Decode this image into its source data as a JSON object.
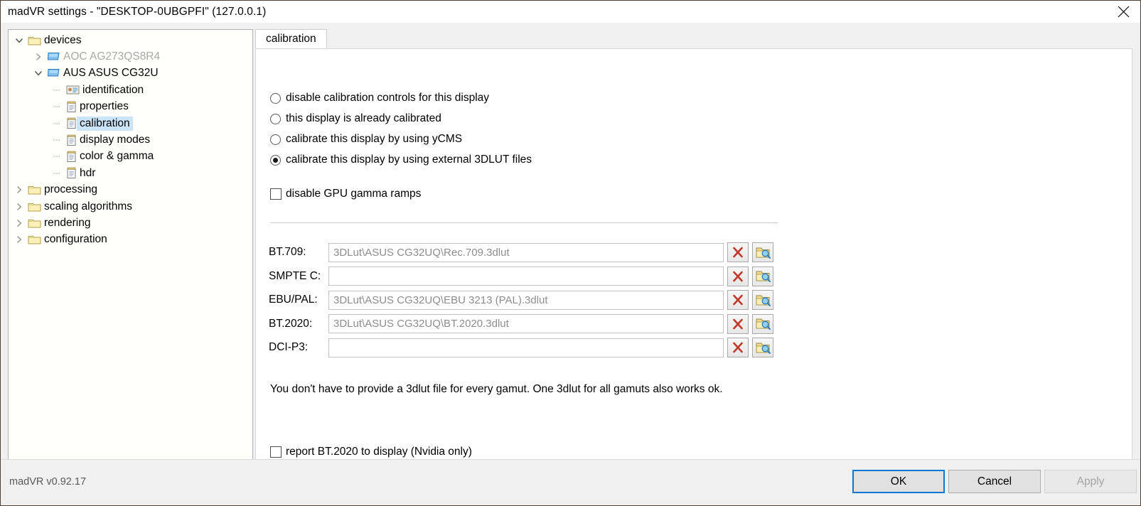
{
  "window": {
    "title": "madVR settings - \"DESKTOP-0UBGPFI\" (127.0.0.1)",
    "close_icon": "close-icon"
  },
  "tree": {
    "items": [
      {
        "label": "devices",
        "depth": 0,
        "icon": "folder-icon",
        "expander": "chevron-down",
        "state": "expanded",
        "dim": false,
        "selected": false
      },
      {
        "label": "AOC AG273QS8R4",
        "depth": 1,
        "icon": "display-icon",
        "expander": "chevron-right",
        "state": "collapsed",
        "dim": true,
        "selected": false
      },
      {
        "label": "AUS ASUS CG32U",
        "depth": 1,
        "icon": "display-icon",
        "expander": "chevron-down",
        "state": "expanded",
        "dim": false,
        "selected": false
      },
      {
        "label": "identification",
        "depth": 2,
        "icon": "id-card-icon",
        "expander": "none",
        "state": "leaf",
        "dim": false,
        "selected": false
      },
      {
        "label": "properties",
        "depth": 2,
        "icon": "page-icon",
        "expander": "none",
        "state": "leaf",
        "dim": false,
        "selected": false
      },
      {
        "label": "calibration",
        "depth": 2,
        "icon": "page-icon",
        "expander": "none",
        "state": "leaf",
        "dim": false,
        "selected": true
      },
      {
        "label": "display modes",
        "depth": 2,
        "icon": "page-icon",
        "expander": "none",
        "state": "leaf",
        "dim": false,
        "selected": false
      },
      {
        "label": "color & gamma",
        "depth": 2,
        "icon": "page-icon",
        "expander": "none",
        "state": "leaf",
        "dim": false,
        "selected": false
      },
      {
        "label": "hdr",
        "depth": 2,
        "icon": "page-icon",
        "expander": "none",
        "state": "leaf",
        "dim": false,
        "selected": false
      },
      {
        "label": "processing",
        "depth": 0,
        "icon": "folder-icon",
        "expander": "chevron-right",
        "state": "collapsed",
        "dim": false,
        "selected": false
      },
      {
        "label": "scaling algorithms",
        "depth": 0,
        "icon": "folder-icon",
        "expander": "chevron-right",
        "state": "collapsed",
        "dim": false,
        "selected": false
      },
      {
        "label": "rendering",
        "depth": 0,
        "icon": "folder-icon",
        "expander": "chevron-right",
        "state": "collapsed",
        "dim": false,
        "selected": false
      },
      {
        "label": "configuration",
        "depth": 0,
        "icon": "folder-icon",
        "expander": "chevron-right",
        "state": "collapsed",
        "dim": false,
        "selected": false
      }
    ]
  },
  "tabs": [
    {
      "label": "calibration",
      "selected": true
    }
  ],
  "calibration": {
    "mode_options": [
      {
        "label": "disable calibration controls for this display",
        "selected": false
      },
      {
        "label": "this display is already calibrated",
        "selected": false
      },
      {
        "label": "calibrate this display by using yCMS",
        "selected": false
      },
      {
        "label": "calibrate this display by using external 3DLUT files",
        "selected": true
      }
    ],
    "disable_gpu_gamma_ramps": {
      "label": "disable GPU gamma ramps",
      "checked": false
    },
    "lut_rows": [
      {
        "label": "BT.709:",
        "value": "3DLut\\ASUS CG32UQ\\Rec.709.3dlut",
        "placeholder": ""
      },
      {
        "label": "SMPTE C:",
        "value": "",
        "placeholder": ""
      },
      {
        "label": "EBU/PAL:",
        "value": "3DLut\\ASUS CG32UQ\\EBU 3213 (PAL).3dlut",
        "placeholder": ""
      },
      {
        "label": "BT.2020:",
        "value": "3DLut\\ASUS CG32UQ\\BT.2020.3dlut",
        "placeholder": ""
      },
      {
        "label": "DCI-P3:",
        "value": "",
        "placeholder": ""
      }
    ],
    "clear_icon": "red-x-icon",
    "browse_icon": "folder-search-icon",
    "note": "You don't have to provide a 3dlut file for every gamut. One 3dlut for all gamuts also works ok.",
    "report_bt2020": {
      "label": "report BT.2020 to display  (Nvidia only)",
      "checked": false
    }
  },
  "footer": {
    "version": "madVR v0.92.17",
    "ok_label": "OK",
    "cancel_label": "Cancel",
    "apply_label": "Apply",
    "apply_enabled": false
  },
  "colors": {
    "selection_blue": "#cce4f7",
    "focus_blue": "#0078d7",
    "clear_red": "#c0392b",
    "folder_yellow": "#f0d27a",
    "display_blue": "#6ab3e8",
    "window_bg": "#f0f0f0"
  }
}
